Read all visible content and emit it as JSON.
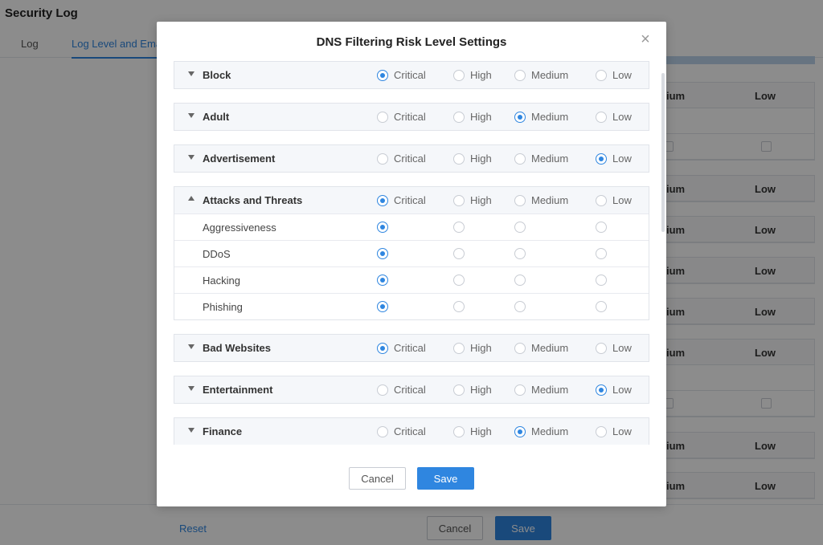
{
  "page": {
    "title": "Security Log",
    "tabs": [
      "Log",
      "Log Level and Ema"
    ],
    "background_headers": {
      "col1": "ium",
      "col2": "Low"
    },
    "reset_label": "Reset",
    "cancel_label": "Cancel",
    "save_label": "Save"
  },
  "modal": {
    "title": "DNS Filtering Risk Level Settings",
    "close_icon": "close-icon",
    "levels": [
      "Critical",
      "High",
      "Medium",
      "Low"
    ],
    "groups": [
      {
        "name": "Block",
        "expanded": false,
        "selected": "Critical"
      },
      {
        "name": "Adult",
        "expanded": false,
        "selected": "Medium"
      },
      {
        "name": "Advertisement",
        "expanded": false,
        "selected": "Low"
      },
      {
        "name": "Attacks and Threats",
        "expanded": true,
        "selected": "Critical",
        "subs": [
          {
            "name": "Aggressiveness",
            "selected": "Critical"
          },
          {
            "name": "DDoS",
            "selected": "Critical"
          },
          {
            "name": "Hacking",
            "selected": "Critical"
          },
          {
            "name": "Phishing",
            "selected": "Critical"
          }
        ]
      },
      {
        "name": "Bad Websites",
        "expanded": false,
        "selected": "Critical"
      },
      {
        "name": "Entertainment",
        "expanded": false,
        "selected": "Low"
      },
      {
        "name": "Finance",
        "expanded": false,
        "selected": "Medium"
      }
    ],
    "cancel_label": "Cancel",
    "save_label": "Save"
  },
  "colors": {
    "accent": "#2f86e0",
    "overlay": "rgba(0,0,0,0.45)"
  }
}
